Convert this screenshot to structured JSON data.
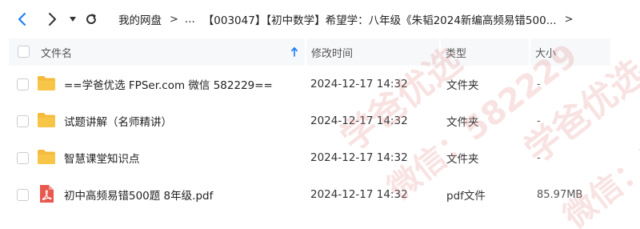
{
  "nav": {
    "back_icon": "chevron-left-icon",
    "forward_icon": "chevron-right-icon",
    "dropdown_icon": "caret-down-icon",
    "refresh_icon": "refresh-icon"
  },
  "breadcrumb": {
    "root": "我的网盘",
    "ellipsis": "...",
    "current": "【003047】【初中数学】希望学：八年级《朱韬2024新编高频易错500...",
    "separator": ">"
  },
  "columns": {
    "name": "文件名",
    "modified": "修改时间",
    "type": "类型",
    "size": "大小"
  },
  "files": [
    {
      "name": "==学爸优选 FPSer.com 微信 582229==",
      "modified": "2024-12-17 14:32",
      "type": "文件夹",
      "size": "-",
      "icon": "folder-icon"
    },
    {
      "name": "试题讲解（名师精讲）",
      "modified": "2024-12-17 14:32",
      "type": "文件夹",
      "size": "-",
      "icon": "folder-icon"
    },
    {
      "name": "智慧课堂知识点",
      "modified": "2024-12-17 14:32",
      "type": "文件夹",
      "size": "-",
      "icon": "folder-icon"
    },
    {
      "name": "初中高频易错500题 8年级.pdf",
      "modified": "2024-12-17 14:32",
      "type": "pdf文件",
      "size": "85.97MB",
      "icon": "pdf-file-icon"
    }
  ],
  "watermark": {
    "line1": "学爸优选",
    "line2": "微信：582229"
  },
  "colors": {
    "folder": "#f7c548",
    "pdf": "#e8584f",
    "header_bg": "#f7f8fa",
    "sort_arrow": "#1677ff"
  }
}
